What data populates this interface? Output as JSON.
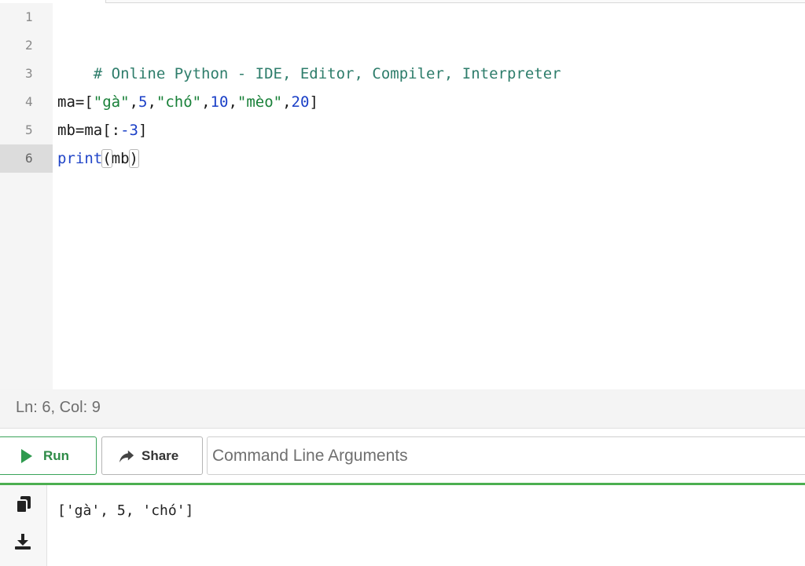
{
  "editor": {
    "line_numbers": [
      "1",
      "2",
      "3",
      "4",
      "5",
      "6"
    ],
    "line2": "# Online Python - IDE, Editor, Compiler, Interpreter",
    "line4": {
      "a": "ma=[",
      "s1": "\"gà\"",
      "c1": ",",
      "n1": "5",
      "c2": ",",
      "s2": "\"chó\"",
      "c3": ",",
      "n2": "10",
      "c4": ",",
      "s3": "\"mèo\"",
      "c5": ",",
      "n3": "20",
      "e": "]"
    },
    "line5": {
      "a": "mb=ma[:",
      "n": "-3",
      "e": "]"
    },
    "line6": {
      "kw": "print",
      "open": "(",
      "arg": "mb",
      "close": ")"
    }
  },
  "status": {
    "cursor": "Ln: 6,  Col: 9"
  },
  "toolbar": {
    "run_label": "Run",
    "share_label": "Share",
    "args_placeholder": "Command Line Arguments"
  },
  "output": {
    "text": "['gà', 5, 'chó']"
  },
  "colors": {
    "accent": "#4caf50",
    "run": "#2e8b47"
  }
}
